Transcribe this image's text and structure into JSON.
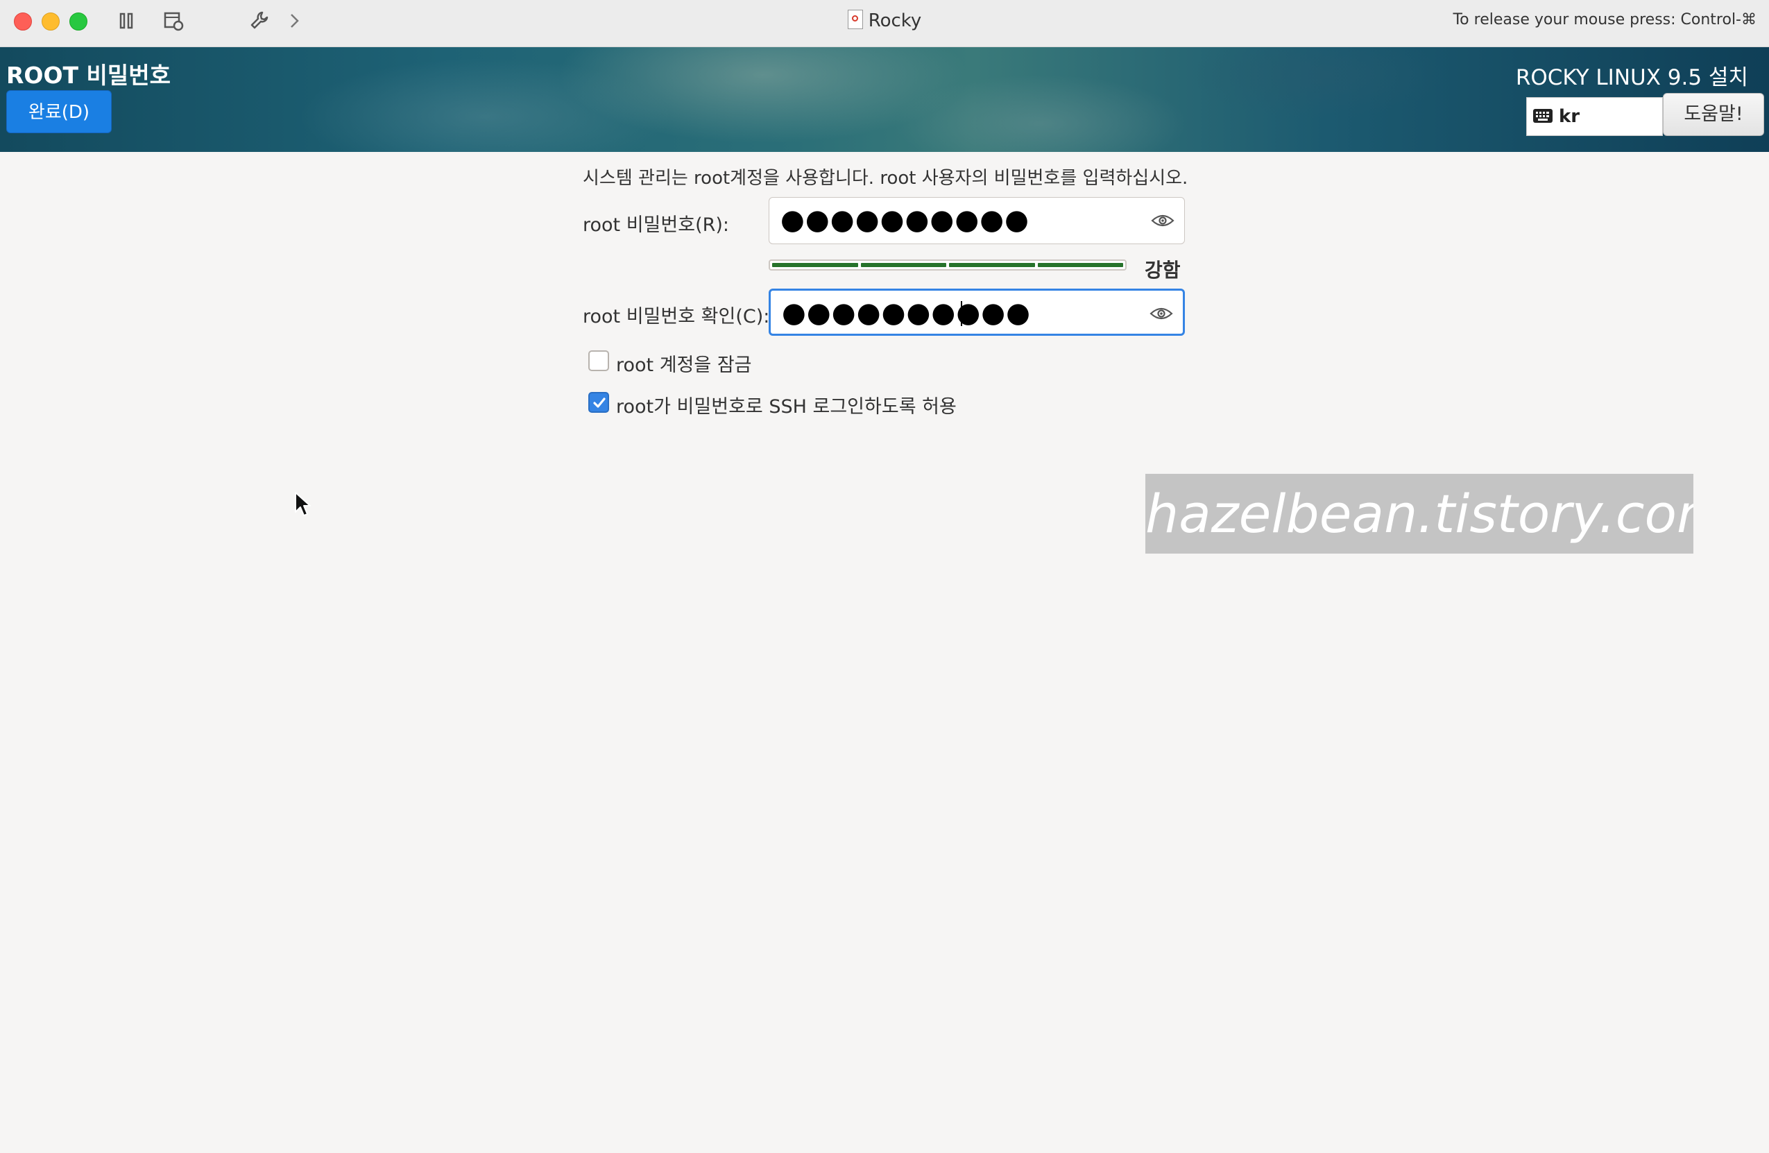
{
  "window": {
    "title": "Rocky",
    "release_hint": "To release your mouse press: Control-⌘"
  },
  "header": {
    "title": "ROOT 비밀번호",
    "done_label": "완료(D)",
    "product": "ROCKY LINUX 9.5 설치",
    "keyboard_layout": "kr",
    "help_label": "도움말!"
  },
  "form": {
    "intro": "시스템 관리는 root계정을 사용합니다. root 사용자의 비밀번호를 입력하십시오.",
    "password_label": "root 비밀번호(R):",
    "password_value": "●●●●●●●●●●",
    "strength_label": "강함",
    "strength_level": 1.0,
    "confirm_label": "root 비밀번호 확인(C):",
    "confirm_value": "●●●●●●●●●●",
    "lock_label": "root 계정을 잠금",
    "lock_checked": false,
    "ssh_label": "root가 비밀번호로 SSH 로그인하도록 허용",
    "ssh_checked": true
  },
  "watermark": "hazelbean.tistory.com",
  "colors": {
    "accent": "#3584e4",
    "done_button": "#1a7fe3",
    "strength": "#26722a"
  }
}
